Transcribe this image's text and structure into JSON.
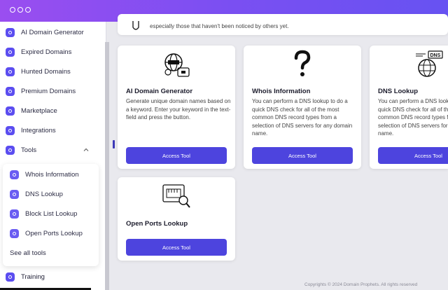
{
  "sidebar": {
    "items": [
      {
        "label": "AI Domain Generator"
      },
      {
        "label": "Expired Domains"
      },
      {
        "label": "Hunted Domains"
      },
      {
        "label": "Premium Domains"
      },
      {
        "label": "Marketplace"
      },
      {
        "label": "Integrations"
      },
      {
        "label": "Tools"
      }
    ],
    "submenu": [
      {
        "label": "Whois Information"
      },
      {
        "label": "DNS Lookup"
      },
      {
        "label": "Block List Lookup"
      },
      {
        "label": "Open Ports Lookup"
      }
    ],
    "see_all": "See all tools",
    "training": "Training"
  },
  "banner": {
    "text": "especially those that haven't been noticed by others yet."
  },
  "cards": [
    {
      "title": "AI Domain Generator",
      "desc": "Generate unique domain names based on a keyword. Enter your keyword in the text-field and press the button.",
      "button": "Access Tool",
      "icon": "ai-globe-icon"
    },
    {
      "title": "Whois Information",
      "desc": "You can perform a DNS lookup to do a quick DNS check for all of the most common DNS record types from a selection of DNS servers for any domain name.",
      "button": "Access Tool",
      "icon": "question-mark-icon"
    },
    {
      "title": "DNS Lookup",
      "desc": "You can perform a DNS lookup to do a quick DNS check for all of the most common DNS record types from a selection of DNS servers for any domain name.",
      "button": "Access Tool",
      "icon": "dns-globe-icon"
    },
    {
      "title": "Open Ports Lookup",
      "button": "Access Tool",
      "icon": "port-magnifier-icon"
    }
  ],
  "footer": "Copyrights © 2024 Domain Prophets. All rights reserved",
  "colors": {
    "accent": "#4d44de",
    "topbar_start": "#9a4ef0",
    "topbar_end": "#6752f2"
  }
}
